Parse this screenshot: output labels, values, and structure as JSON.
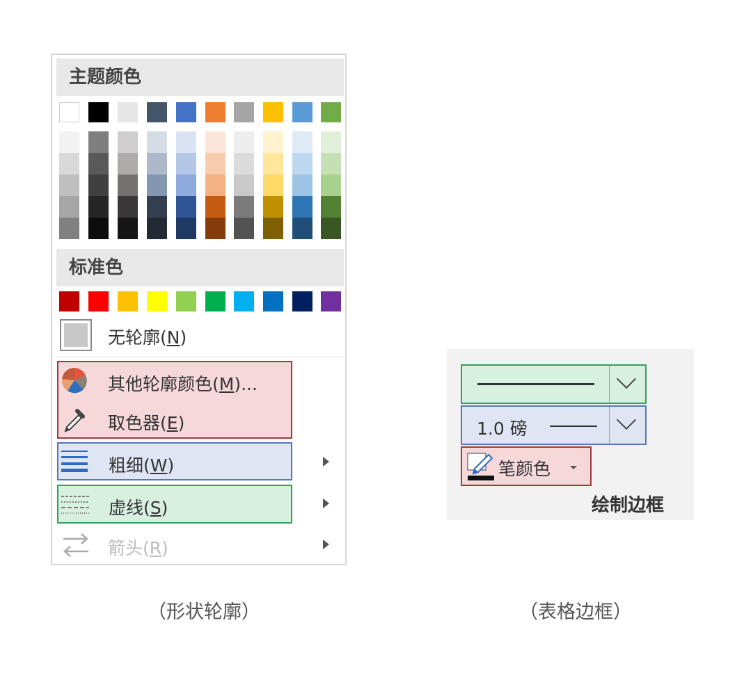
{
  "outline_menu": {
    "theme_colors_label": "主题颜色",
    "theme_colors": [
      "#ffffff",
      "#000000",
      "#e7e6e6",
      "#44546a",
      "#4472c4",
      "#ed7d31",
      "#a5a5a5",
      "#ffc000",
      "#5b9bd5",
      "#70ad47"
    ],
    "theme_shades": [
      [
        "#f2f2f2",
        "#d9d9d9",
        "#bfbfbf",
        "#a6a6a6",
        "#808080"
      ],
      [
        "#7f7f7f",
        "#595959",
        "#404040",
        "#262626",
        "#0d0d0d"
      ],
      [
        "#d0cece",
        "#aeaaaa",
        "#757171",
        "#3a3838",
        "#171616"
      ],
      [
        "#d6dce5",
        "#adb9ca",
        "#8497b0",
        "#333f50",
        "#222a35"
      ],
      [
        "#dae3f3",
        "#b4c7e7",
        "#8faadc",
        "#2f5597",
        "#203864"
      ],
      [
        "#fbe5d6",
        "#f8cbad",
        "#f4b183",
        "#c55a11",
        "#843c0c"
      ],
      [
        "#ededed",
        "#dbdbdb",
        "#c9c9c9",
        "#7b7b7b",
        "#525252"
      ],
      [
        "#fff2cc",
        "#ffe699",
        "#ffd966",
        "#bf9000",
        "#7f6000"
      ],
      [
        "#deebf7",
        "#bdd7ee",
        "#9dc3e6",
        "#2e75b6",
        "#1f4e79"
      ],
      [
        "#e2f0d9",
        "#c5e0b4",
        "#a9d18e",
        "#548235",
        "#385723"
      ]
    ],
    "standard_colors_label": "标准色",
    "standard_colors": [
      "#c00000",
      "#ff0000",
      "#ffc000",
      "#ffff00",
      "#92d050",
      "#00b050",
      "#00b0f0",
      "#0070c0",
      "#002060",
      "#7030a0"
    ],
    "no_outline": {
      "label": "无轮廓(",
      "key": "N",
      "end": ")"
    },
    "more_colors": {
      "label": "其他轮廓颜色(",
      "key": "M",
      "end": ")..."
    },
    "eyedropper": {
      "label": "取色器(",
      "key": "E",
      "end": ")"
    },
    "weight": {
      "label": "粗细(",
      "key": "W",
      "end": ")"
    },
    "dashes": {
      "label": "虚线(",
      "key": "S",
      "end": ")"
    },
    "arrows": {
      "label": "箭头(",
      "key": "R",
      "end": ")"
    },
    "caption": "（形状轮廓）"
  },
  "border_panel": {
    "pen_weight": "1.0 磅",
    "pen_color": "笔颜色",
    "group_label": "绘制边框",
    "caption": "（表格边框）"
  },
  "highlight_colors": {
    "red": "#a33a3a",
    "red_fill": "#f6d8db",
    "blue": "#5477c0",
    "blue_fill": "#dfe5f2",
    "green": "#2ea35a",
    "green_fill": "#d7f0e0"
  }
}
